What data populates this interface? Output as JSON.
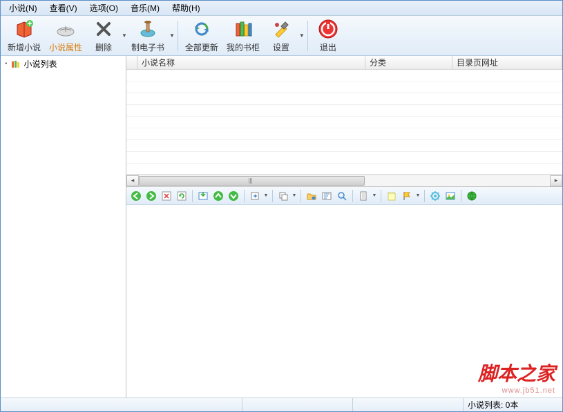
{
  "menu": {
    "novel": "小说(N)",
    "view": "查看(V)",
    "options": "选项(O)",
    "music": "音乐(M)",
    "help": "帮助(H)"
  },
  "toolbar": {
    "add_novel": "新增小说",
    "properties": "小说属性",
    "delete": "删除",
    "make_ebook": "制电子书",
    "update_all": "全部更新",
    "bookshelf": "我的书柜",
    "settings": "设置",
    "exit": "退出"
  },
  "sidebar": {
    "root": "小说列表"
  },
  "table": {
    "columns": {
      "name": "小说名称",
      "category": "分类",
      "toc_url": "目录页网址"
    },
    "rows": []
  },
  "status": {
    "novel_count": "小说列表: 0本"
  },
  "watermark": {
    "title": "脚本之家",
    "url": "www.jb51.net"
  },
  "icons": {
    "add_novel": "book-plus-icon",
    "properties": "book-open-icon",
    "delete": "x-icon",
    "make_ebook": "brush-icon",
    "update_all": "refresh-icon",
    "bookshelf": "books-icon",
    "settings": "tools-icon",
    "exit": "power-icon"
  }
}
